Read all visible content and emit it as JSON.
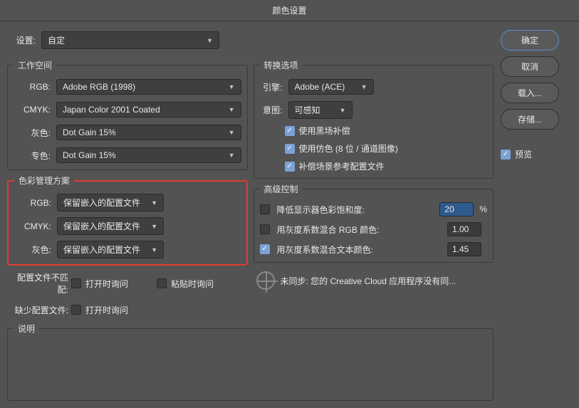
{
  "title": "颜色设置",
  "settings": {
    "label": "设置:",
    "value": "自定"
  },
  "workspace": {
    "legend": "工作空间",
    "rgb_label": "RGB:",
    "rgb_value": "Adobe RGB (1998)",
    "cmyk_label": "CMYK:",
    "cmyk_value": "Japan Color 2001 Coated",
    "gray_label": "灰色:",
    "gray_value": "Dot Gain 15%",
    "spot_label": "专色:",
    "spot_value": "Dot Gain 15%"
  },
  "policies": {
    "legend": "色彩管理方案",
    "rgb_label": "RGB:",
    "rgb_value": "保留嵌入的配置文件",
    "cmyk_label": "CMYK:",
    "cmyk_value": "保留嵌入的配置文件",
    "gray_label": "灰色:",
    "gray_value": "保留嵌入的配置文件"
  },
  "mismatch": {
    "label": "配置文件不匹配:",
    "ask_open": "打开时询问",
    "ask_open_checked": false,
    "ask_paste": "粘贴时询问",
    "ask_paste_checked": false
  },
  "missing": {
    "label": "缺少配置文件:",
    "ask_open": "打开时询问",
    "ask_open_checked": false
  },
  "conversion": {
    "legend": "转换选项",
    "engine_label": "引擎:",
    "engine_value": "Adobe (ACE)",
    "intent_label": "意图:",
    "intent_value": "可感知",
    "blackpoint": "使用黑场补偿",
    "blackpoint_checked": true,
    "dither": "使用仿色 (8 位 / 通道图像)",
    "dither_checked": true,
    "compensate": "补偿场景参考配置文件",
    "compensate_checked": true
  },
  "advanced": {
    "legend": "高级控制",
    "desat": "降低显示器色彩饱和度:",
    "desat_checked": false,
    "desat_value": "20",
    "desat_unit": "%",
    "blend_rgb": "用灰度系数混合 RGB 颜色:",
    "blend_rgb_checked": false,
    "blend_rgb_value": "1.00",
    "blend_text": "用灰度系数混合文本颜色:",
    "blend_text_checked": true,
    "blend_text_value": "1.45"
  },
  "sync_msg": "未同步: 您的 Creative Cloud 应用程序没有同...",
  "description": {
    "legend": "说明"
  },
  "buttons": {
    "ok": "确定",
    "cancel": "取消",
    "load": "载入...",
    "save": "存储...",
    "preview": "预览",
    "preview_checked": true
  }
}
